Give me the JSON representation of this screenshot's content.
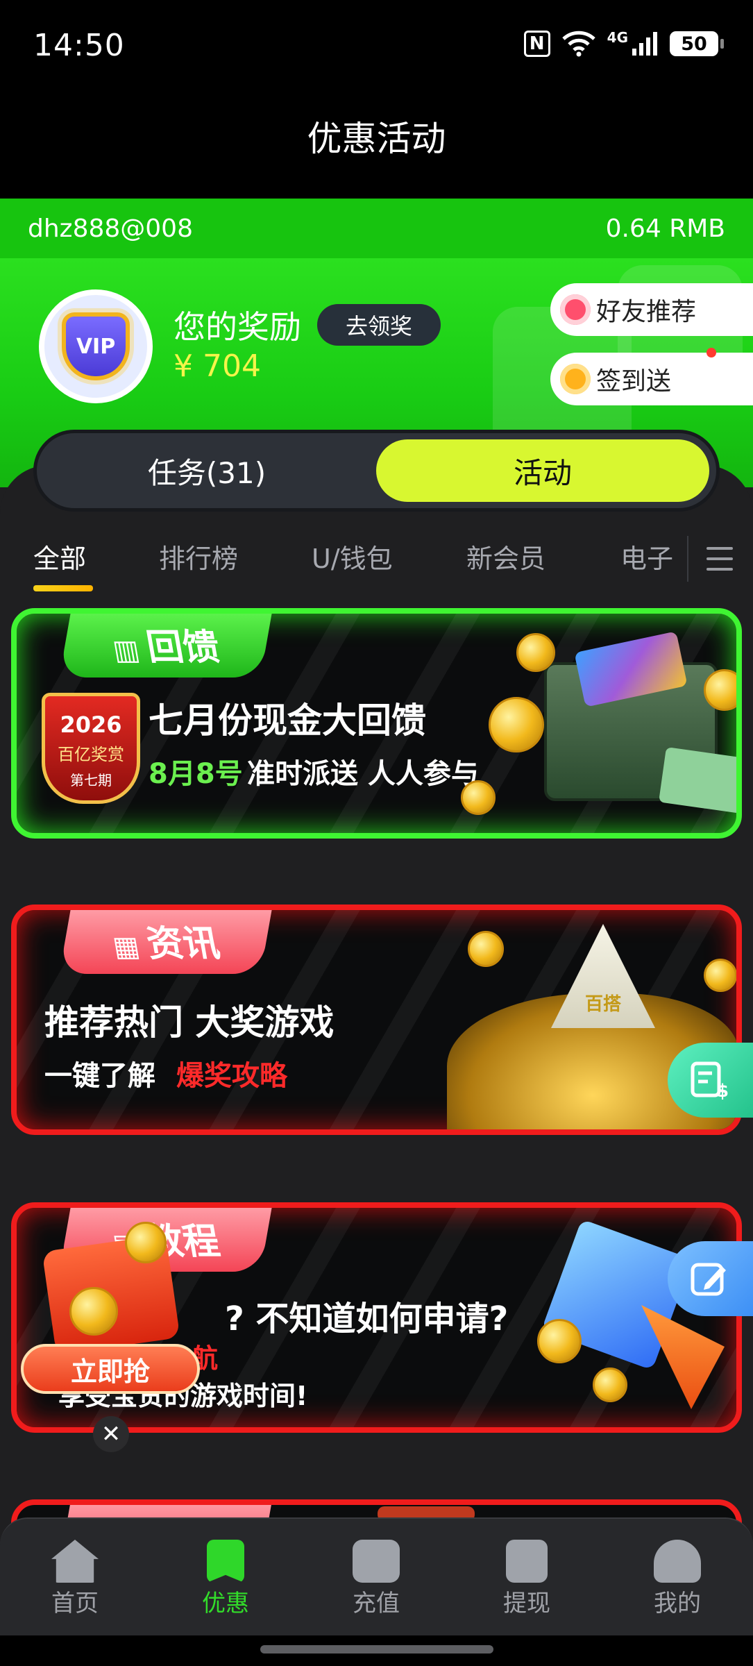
{
  "status_bar": {
    "time": "14:50",
    "network": "4G",
    "battery": "50"
  },
  "header": {
    "title": "优惠活动"
  },
  "user": {
    "account": "dhz888@008",
    "balance": "0.64 RMB"
  },
  "reward": {
    "label": "您的奖励",
    "claim_button": "去领奖",
    "amount": "¥ 704",
    "avatar_text": "VIP"
  },
  "side_pills": [
    {
      "label": "好友推荐"
    },
    {
      "label": "签到送"
    }
  ],
  "segment": {
    "tasks": "任务(31)",
    "activities": "活动",
    "active": "活动"
  },
  "category_tabs": [
    {
      "label": "全部",
      "active": true
    },
    {
      "label": "排行榜"
    },
    {
      "label": "U/钱包"
    },
    {
      "label": "新会员"
    },
    {
      "label": "电子"
    }
  ],
  "banners": [
    {
      "tag": "回馈",
      "badge_year": "2026",
      "badge_text": "百亿奖赏",
      "badge_sub": "第七期",
      "headline": "七月份现金大回馈",
      "sub_highlight": "8月8号",
      "sub_rest": "准时派送 人人参与"
    },
    {
      "tag": "资讯",
      "headline": "推荐热门 大奖游戏",
      "sub_plain": "一键了解",
      "sub_highlight": "爆奖攻略",
      "tile_text": "百搭"
    },
    {
      "tag": "教程",
      "headline": "? 不知道如何申请?",
      "sub_highlight": "航",
      "sub_rest": "享受宝贵的游戏时间!"
    }
  ],
  "promo": {
    "button": "立即抢",
    "close": "✕"
  },
  "nav": [
    {
      "label": "首页",
      "icon": "home-icon"
    },
    {
      "label": "优惠",
      "icon": "star-icon",
      "active": true
    },
    {
      "label": "充值",
      "icon": "wallet-icon"
    },
    {
      "label": "提现",
      "icon": "withdraw-icon"
    },
    {
      "label": "我的",
      "icon": "profile-icon"
    }
  ],
  "colors": {
    "brand_green": "#1fd21a",
    "accent_lime": "#d8f730",
    "gold": "#f5f54a",
    "highlight_red": "#ff2a2a"
  }
}
